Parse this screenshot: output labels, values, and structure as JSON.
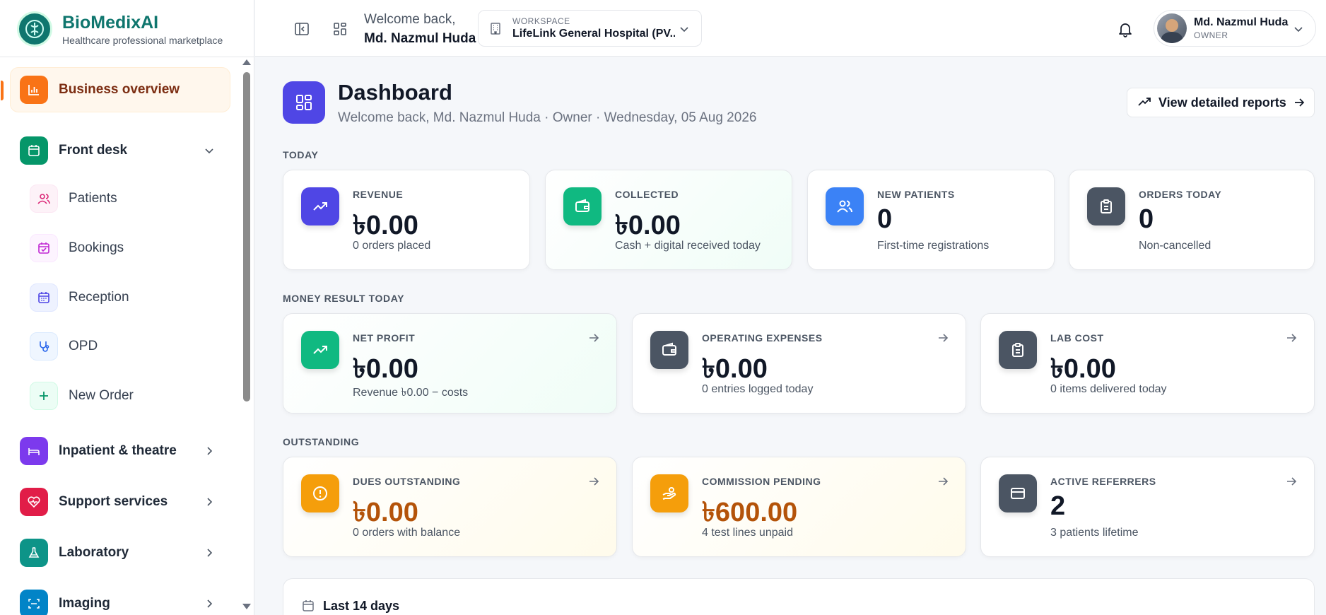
{
  "brand": {
    "name": "BioMedixAI",
    "tagline": "Healthcare professional marketplace"
  },
  "sidebar": {
    "active": {
      "label": "Business overview"
    },
    "front_desk": {
      "label": "Front desk",
      "items": [
        {
          "label": "Patients"
        },
        {
          "label": "Bookings"
        },
        {
          "label": "Reception"
        },
        {
          "label": "OPD"
        },
        {
          "label": "New Order"
        }
      ]
    },
    "groups": [
      {
        "label": "Inpatient & theatre"
      },
      {
        "label": "Support services"
      },
      {
        "label": "Laboratory"
      },
      {
        "label": "Imaging"
      }
    ]
  },
  "topbar": {
    "welcome_line1": "Welcome back,",
    "welcome_name": "Md. Nazmul Huda",
    "workspace_label": "WORKSPACE",
    "workspace_name": "LifeLink General Hospital (PV...",
    "user_name": "Md. Nazmul Huda",
    "user_role": "OWNER"
  },
  "page": {
    "title": "Dashboard",
    "subtitle": "Welcome back, Md. Nazmul Huda · Owner · Wednesday, 05 Aug 2026",
    "report_button": "View detailed reports"
  },
  "sections": {
    "today": "TODAY",
    "money": "MONEY RESULT TODAY",
    "outstanding": "OUTSTANDING"
  },
  "today_cards": [
    {
      "label": "REVENUE",
      "value": "৳0.00",
      "sub": "0 orders placed"
    },
    {
      "label": "COLLECTED",
      "value": "৳0.00",
      "sub": "Cash + digital received today"
    },
    {
      "label": "NEW PATIENTS",
      "value": "0",
      "sub": "First-time registrations"
    },
    {
      "label": "ORDERS TODAY",
      "value": "0",
      "sub": "Non-cancelled"
    }
  ],
  "money_cards": [
    {
      "label": "NET PROFIT",
      "value": "৳0.00",
      "sub": "Revenue ৳0.00 − costs"
    },
    {
      "label": "OPERATING EXPENSES",
      "value": "৳0.00",
      "sub": "0 entries logged today"
    },
    {
      "label": "LAB COST",
      "value": "৳0.00",
      "sub": "0 items delivered today"
    }
  ],
  "outstanding_cards": [
    {
      "label": "DUES OUTSTANDING",
      "value": "৳0.00",
      "sub": "0 orders with balance"
    },
    {
      "label": "COMMISSION PENDING",
      "value": "৳600.00",
      "sub": "4 test lines unpaid"
    },
    {
      "label": "ACTIVE REFERRERS",
      "value": "2",
      "sub": "3 patients lifetime"
    }
  ],
  "chart_section": {
    "title": "Last 14 days"
  },
  "colors": {
    "brand": "#0f766e",
    "active_bg": "#fff7ed",
    "indigo": "#4f46e5",
    "green": "#10b981",
    "blue": "#3b82f6",
    "slate": "#4b5563",
    "amber": "#f59e0b",
    "amber_text": "#b45309"
  }
}
